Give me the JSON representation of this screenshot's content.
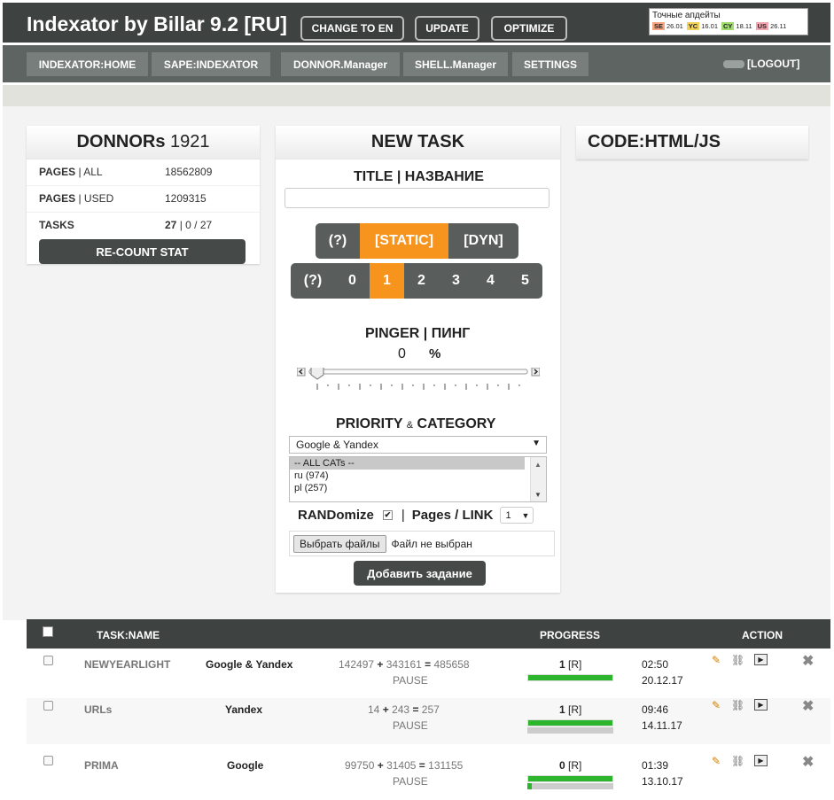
{
  "header": {
    "title": "Indexator by Billar 9.2 [RU]",
    "buttons": [
      "CHANGE TO EN",
      "UPDATE",
      "OPTIMIZE"
    ],
    "updates": {
      "title": "Точные апдейты",
      "items": [
        {
          "tag": "SE",
          "date": "26.01",
          "color": "#f4a682"
        },
        {
          "tag": "YC",
          "date": "16.01",
          "color": "#f2d25a"
        },
        {
          "tag": "CY",
          "date": "18.11",
          "color": "#9edc6e"
        },
        {
          "tag": "US",
          "date": "26.11",
          "color": "#f4a6b0"
        }
      ]
    }
  },
  "nav": {
    "items": [
      "INDEXATOR:HOME",
      "SAPE:INDEXATOR",
      "DONNOR.Manager",
      "SHELL.Manager",
      "SETTINGS"
    ],
    "logout": "[LOGOUT]"
  },
  "donnors": {
    "title": "DONNORs",
    "count": "1921",
    "pages_all_a": "PAGES",
    "pages_all_b": "ALL",
    "pages_all_val": "18562809",
    "pages_used_a": "PAGES",
    "pages_used_b": "USED",
    "pages_used_val": "1209315",
    "tasks_label": "TASKS",
    "tasks_a": "27",
    "tasks_b": "0",
    "tasks_c": "27",
    "recount": "RE-COUNT STAT"
  },
  "new_task": {
    "title": "NEW TASK",
    "title_label": "TITLE | НАЗВАНИЕ",
    "type_options": [
      "(?)",
      "[STATIC]",
      "[DYN]"
    ],
    "type_selected": 1,
    "level_options": [
      "(?)",
      "0",
      "1",
      "2",
      "3",
      "4",
      "5"
    ],
    "level_selected": 2,
    "pinger_label": "PINGER | ПИНГ",
    "pinger_value": "0",
    "pinger_unit": "%",
    "pinger_level": 0,
    "priority_a": "PRIORITY",
    "priority_amp": "&",
    "priority_b": "CATEGORY",
    "engine_selected": "Google & Yandex",
    "categories": [
      "-- ALL CATs --",
      "ru (974)",
      "pl (257)"
    ],
    "randomize_label": "RANDomize",
    "randomize_checked": true,
    "pages_link_label": "Pages / LINK",
    "pages_link_value": "1",
    "file_button": "Выбрать файлы",
    "file_status": "Файл не выбран",
    "submit": "Добавить задание"
  },
  "code": {
    "title": "CODE:HTML/JS"
  },
  "table": {
    "columns": [
      "TASK:NAME",
      "PROGRESS",
      "ACTION"
    ],
    "rows": [
      {
        "name": "NEWYEARLIGHT",
        "engine": "Google & Yandex",
        "a": "142497",
        "b": "343161",
        "c": "485658",
        "status": "PAUSE",
        "prog": "1",
        "flag": "[R]",
        "time": "02:50",
        "date": "20.12.17",
        "done": 1.0,
        "second": 0.0
      },
      {
        "name": "URLs",
        "engine": "Yandex",
        "a": "14",
        "b": "243",
        "c": "257",
        "status": "PAUSE",
        "prog": "1",
        "flag": "[R]",
        "time": "09:46",
        "date": "14.11.17",
        "done": 1.0,
        "second": 0.0
      },
      {
        "name": "PRIMA",
        "engine": "Google",
        "a": "99750",
        "b": "31405",
        "c": "131155",
        "status": "PAUSE",
        "prog": "0",
        "flag": "[R]",
        "time": "01:39",
        "date": "13.10.17",
        "done": 1.0,
        "second": 0.05
      }
    ]
  },
  "colors": {
    "accent": "#f7941d",
    "dark": "#3e4240",
    "progress": "#2db52d"
  }
}
